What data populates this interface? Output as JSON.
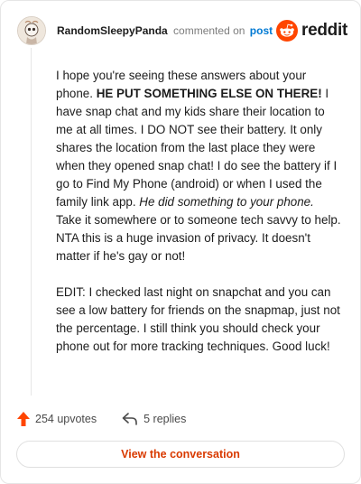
{
  "header": {
    "username": "RandomSleepyPanda",
    "commented_on": "commented on",
    "post_link": "post",
    "brand": "reddit",
    "brand_color": "#ff4500"
  },
  "comment": {
    "p1_a": "I hope you're seeing these answers about your phone. ",
    "p1_bold": "HE PUT SOMETHING ELSE ON THERE!",
    "p1_b": " I have snap chat and my kids share their location to me at all times. I DO NOT see their battery. It only shares the location from the last place they were when they opened snap chat! I do see the battery if I go to Find My Phone (android) or when I used the family link app. ",
    "p1_italic": "He did something to your phone.",
    "p1_c": " Take it somewhere or to someone tech savvy to help. NTA this is a huge invasion of privacy. It doesn't matter if he's gay or not!",
    "p2": "EDIT: I checked last night on snapchat and you can see a low battery for friends on the snapmap, just not the percentage. I still think you should check your phone out for more tracking techniques. Good luck!"
  },
  "footer": {
    "upvotes": "254 upvotes",
    "replies": "5 replies",
    "upvote_color": "#ff4500"
  },
  "cta": {
    "label": "View the conversation",
    "color": "#d93a00"
  },
  "icons": {
    "avatar": "avatar-image",
    "brand": "reddit-snoo-icon",
    "upvote": "upvote-arrow-icon",
    "reply": "reply-arrow-icon"
  }
}
